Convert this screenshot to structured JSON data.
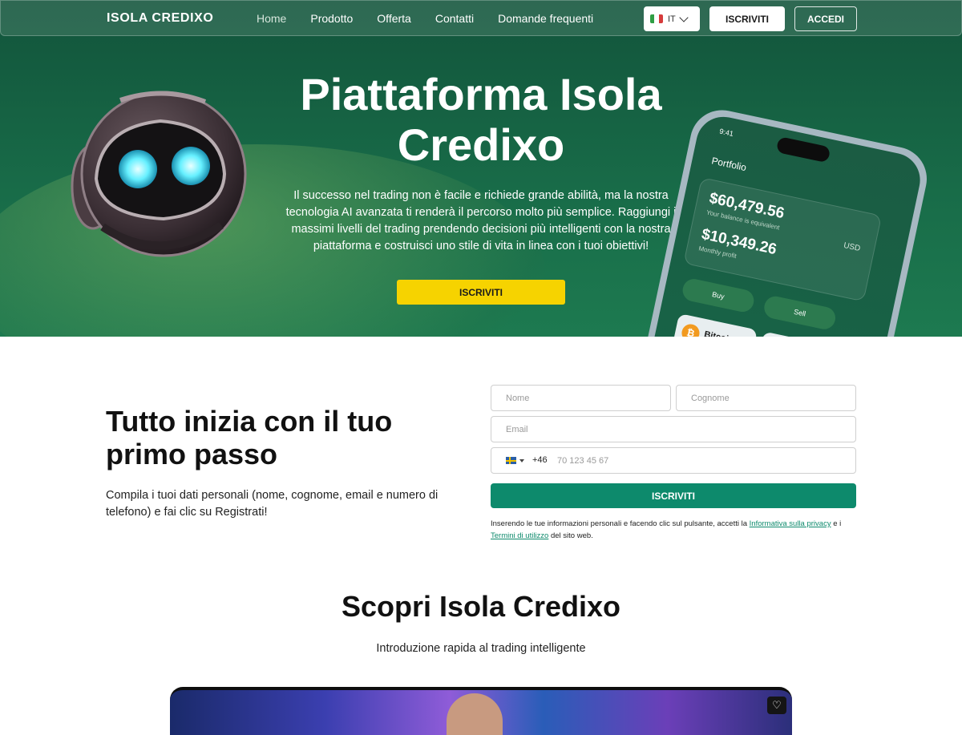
{
  "nav": {
    "logo": "ISOLA CREDIXO",
    "links": [
      "Home",
      "Prodotto",
      "Offerta",
      "Contatti",
      "Domande frequenti"
    ],
    "language": "IT",
    "signup_label": "ISCRIVITI",
    "login_label": "ACCEDI"
  },
  "hero": {
    "title": "Piattaforma Isola Credixo",
    "description": "Il successo nel trading non è facile e richiede grande abilità, ma la nostra tecnologia AI avanzata ti renderà il percorso molto più semplice. Raggiungi i massimi livelli del trading prendendo decisioni più intelligenti con la nostra piattaforma e costruisci uno stile di vita in linea con i tuoi obiettivi!",
    "cta_label": "ISCRIVITI",
    "phone": {
      "time": "9:41",
      "title": "Portfolio",
      "balance": "$60,479.56",
      "balance_caption": "Your balance is equivalent",
      "currency": "USD",
      "profit": "$10,349.26",
      "profit_caption": "Monthly profit",
      "buy_label": "Buy",
      "sell_label": "Sell",
      "coin": "Bitcoin"
    }
  },
  "signup": {
    "heading": "Tutto inizia con il tuo primo passo",
    "text": "Compila i tuoi dati personali (nome, cognome, email e numero di telefono) e fai clic su Registrati!",
    "name_placeholder": "Nome",
    "surname_placeholder": "Cognome",
    "email_placeholder": "Email",
    "dial_code": "+46",
    "phone_placeholder": "70 123 45 67",
    "submit_label": "ISCRIVITI",
    "legal_prefix": "Inserendo le tue informazioni personali e facendo clic sul pulsante, accetti la ",
    "privacy_link": "Informativa sulla privacy",
    "legal_middle": " e i ",
    "terms_link": "Termini di utilizzo",
    "legal_suffix": " del sito web."
  },
  "discover": {
    "title": "Scopri Isola Credixo",
    "subtitle": "Introduzione rapida al trading intelligente"
  },
  "colors": {
    "hero_green": "#186b48",
    "cta_yellow": "#f6d300",
    "submit_teal": "#0d8a6c"
  },
  "icons": [
    "flag-italy-icon",
    "chevron-down-icon",
    "flag-sweden-icon",
    "heart-icon"
  ]
}
